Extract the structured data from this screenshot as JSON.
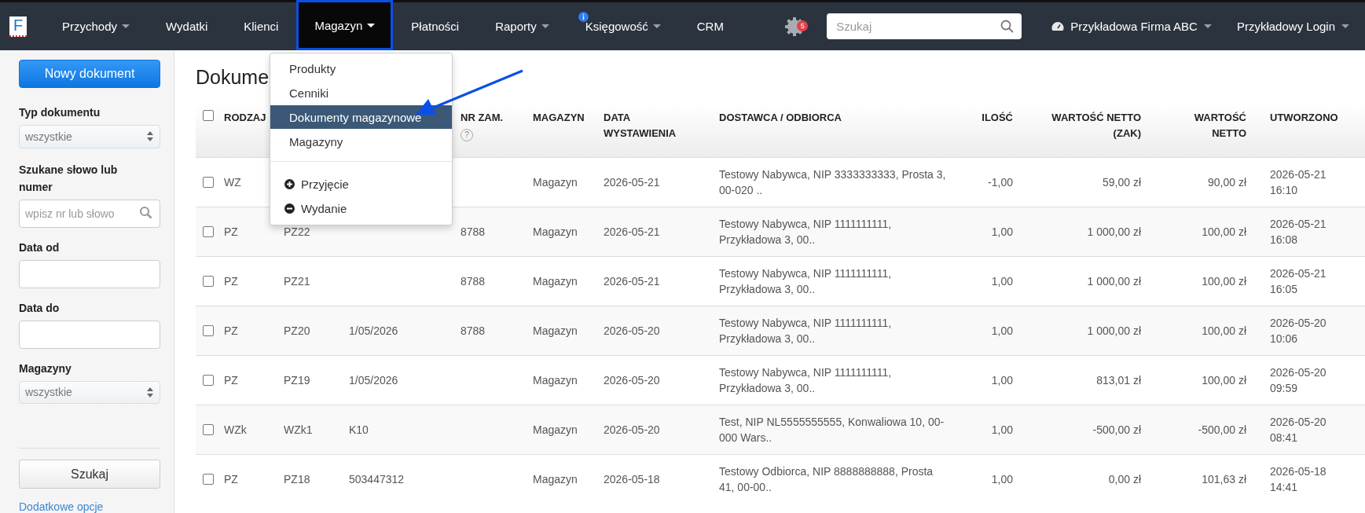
{
  "navbar": {
    "logo": "F",
    "items": [
      {
        "label": "Przychody",
        "caret": true,
        "info": false,
        "selected": false
      },
      {
        "label": "Wydatki",
        "caret": false,
        "info": false,
        "selected": false
      },
      {
        "label": "Klienci",
        "caret": false,
        "info": false,
        "selected": false
      },
      {
        "label": "Magazyn",
        "caret": true,
        "info": false,
        "selected": true
      },
      {
        "label": "Płatności",
        "caret": false,
        "info": false,
        "selected": false
      },
      {
        "label": "Raporty",
        "caret": true,
        "info": false,
        "selected": false
      },
      {
        "label": "Księgowość",
        "caret": true,
        "info": true,
        "selected": false
      },
      {
        "label": "CRM",
        "caret": false,
        "info": false,
        "selected": false
      }
    ],
    "notifications": "5",
    "search": {
      "placeholder": "Szukaj"
    },
    "company": "Przykładowa Firma ABC",
    "user": "Przykładowy Login"
  },
  "dropdown": {
    "items": [
      {
        "kind": "link",
        "label": "Produkty",
        "selected": false
      },
      {
        "kind": "link",
        "label": "Cenniki",
        "selected": false
      },
      {
        "kind": "link",
        "label": "Dokumenty magazynowe",
        "selected": true
      },
      {
        "kind": "link",
        "label": "Magazyny",
        "selected": false
      },
      {
        "kind": "divider"
      },
      {
        "kind": "add",
        "label": "Przyjęcie",
        "selected": false
      },
      {
        "kind": "remove",
        "label": "Wydanie",
        "selected": false
      }
    ]
  },
  "sidebar": {
    "new_button": "Nowy dokument",
    "type_label": "Typ dokumentu",
    "type_value": "wszystkie",
    "search_label": "Szukane słowo lub numer",
    "search_placeholder": "wpisz nr lub słowo",
    "date_from_label": "Data od",
    "date_to_label": "Data do",
    "warehouse_label": "Magazyny",
    "warehouse_value": "wszystkie",
    "search_button": "Szukaj",
    "more_link": "Dodatkowe opcje"
  },
  "title": "Dokume",
  "table": {
    "all_checked": false,
    "columns": {
      "type": "RODZAJ",
      "order_no": "NR ZAM.",
      "order_no_help": "?",
      "warehouse": "MAGAZYN",
      "issue_date": "DATA WYSTAWIENIA",
      "party": "DOSTAWCA / ODBIORCA",
      "qty": "ILOŚĆ",
      "value_purchase": "WARTOŚĆ NETTO (ZAK)",
      "value_net": "WARTOŚĆ NETTO",
      "created": "UTWORZONO"
    },
    "rows": [
      {
        "checked": false,
        "type": "WZ",
        "warehouse": "Magazyn",
        "issue_date": "2026-05-21",
        "party": "Testowy Nabywca, NIP 3333333333, Prosta 3, 00-020 ..",
        "qty": "-1,00",
        "value_purchase": "59,00 zł",
        "value_net": "90,00 zł",
        "created": "2026-05-21 16:10"
      },
      {
        "checked": false,
        "type": "PZ",
        "number": "PZ22",
        "order_no": "8788",
        "warehouse": "Magazyn",
        "issue_date": "2026-05-21",
        "party": "Testowy Nabywca, NIP 1111111111, Przykładowa 3, 00..",
        "qty": "1,00",
        "value_purchase": "1 000,00 zł",
        "value_net": "100,00 zł",
        "created": "2026-05-21 16:08"
      },
      {
        "checked": false,
        "type": "PZ",
        "number": "PZ21",
        "order_no": "8788",
        "warehouse": "Magazyn",
        "issue_date": "2026-05-21",
        "party": "Testowy Nabywca, NIP 1111111111, Przykładowa 3, 00..",
        "qty": "1,00",
        "value_purchase": "1 000,00 zł",
        "value_net": "100,00 zł",
        "created": "2026-05-21 16:05"
      },
      {
        "checked": false,
        "type": "PZ",
        "number": "PZ20",
        "ref": "1/05/2026",
        "order_no": "8788",
        "warehouse": "Magazyn",
        "issue_date": "2026-05-20",
        "party": "Testowy Nabywca, NIP 1111111111, Przykładowa 3, 00..",
        "qty": "1,00",
        "value_purchase": "1 000,00 zł",
        "value_net": "100,00 zł",
        "created": "2026-05-20 10:06"
      },
      {
        "checked": false,
        "type": "PZ",
        "number": "PZ19",
        "ref": "1/05/2026",
        "warehouse": "Magazyn",
        "issue_date": "2026-05-20",
        "party": "Testowy Nabywca, NIP 1111111111, Przykładowa 3, 00..",
        "qty": "1,00",
        "value_purchase": "813,01 zł",
        "value_net": "100,00 zł",
        "created": "2026-05-20 09:59"
      },
      {
        "checked": false,
        "type": "WZk",
        "number": "WZk1",
        "ref": "K10",
        "warehouse": "Magazyn",
        "issue_date": "2026-05-20",
        "party": "Test, NIP NL5555555555, Konwaliowa 10, 00-000 Wars..",
        "qty": "1,00",
        "value_purchase": "-500,00 zł",
        "value_net": "-500,00 zł",
        "created": "2026-05-20 08:41"
      },
      {
        "checked": false,
        "type": "PZ",
        "number": "PZ18",
        "ref": "503447312",
        "warehouse": "Magazyn",
        "issue_date": "2026-05-18",
        "party": "Testowy Odbiorca, NIP 8888888888, Prosta 41, 00-00..",
        "qty": "1,00",
        "value_purchase": "0,00 zł",
        "value_net": "101,63 zł",
        "created": "2026-05-18 14:41"
      }
    ]
  }
}
